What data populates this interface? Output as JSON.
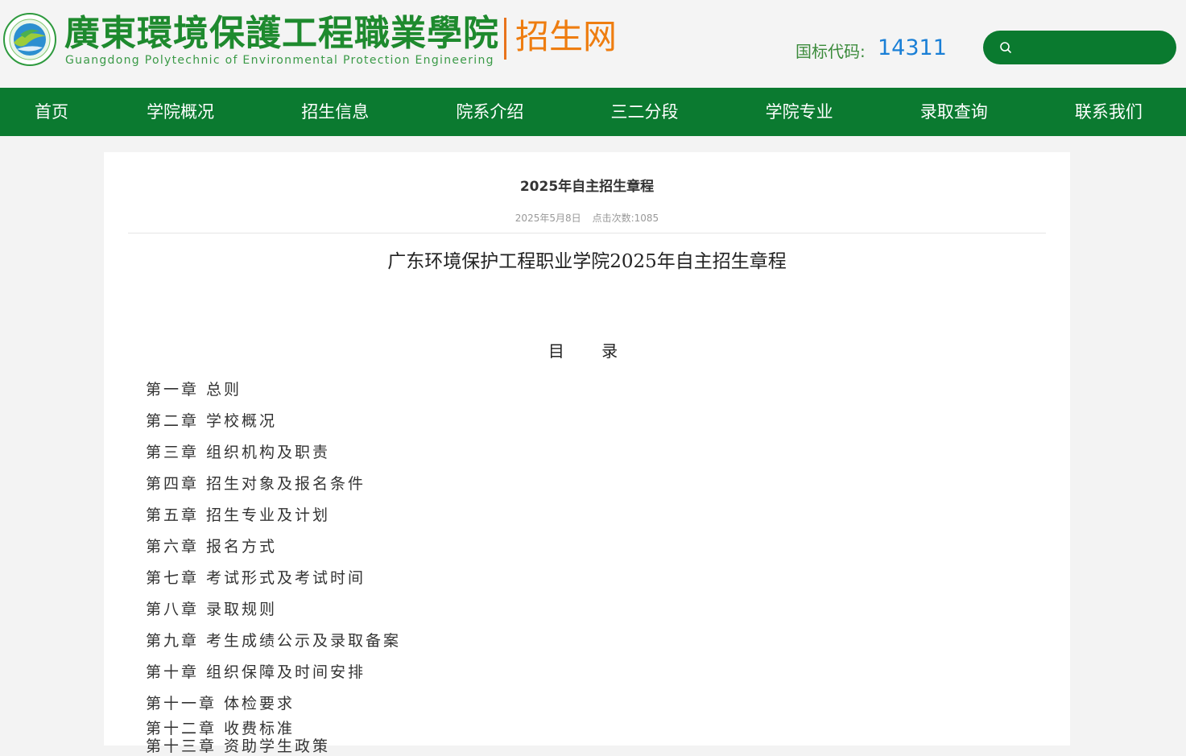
{
  "header": {
    "logo_cn": "廣東環境保護工程職業學院",
    "logo_en": "Guangdong Polytechnic of Environmental Protection Engineering",
    "site_name": "招生网",
    "code_label": "国标代码:",
    "code_value": "14311",
    "search": {
      "placeholder": ""
    }
  },
  "nav": {
    "items": [
      "首页",
      "学院概况",
      "招生信息",
      "院系介绍",
      "三二分段",
      "学院专业",
      "录取查询",
      "联系我们"
    ]
  },
  "article": {
    "title": "2025年自主招生章程",
    "date": "2025年5月8日",
    "hits": "点击次数:1085",
    "doc_title": "广东环境保护工程职业学院2025年自主招生章程",
    "toc_heading": "目 录",
    "toc": [
      "第一章 总则",
      "第二章 学校概况",
      "第三章 组织机构及职责",
      "第四章 招生对象及报名条件",
      "第五章 招生专业及计划",
      "第六章 报名方式",
      "第七章 考试形式及考试时间",
      "第八章 录取规则",
      "第九章 考生成绩公示及录取备案",
      "第十章 组织保障及时间安排",
      "第十一章 体检要求",
      "第十二章 收费标准",
      "第十三章 资助学生政策"
    ]
  },
  "colors": {
    "nav_bg": "#0b7a30",
    "logo_green": "#1e8a2e",
    "site_orange": "#ee7d10",
    "code_blue": "#1a7fd6"
  }
}
